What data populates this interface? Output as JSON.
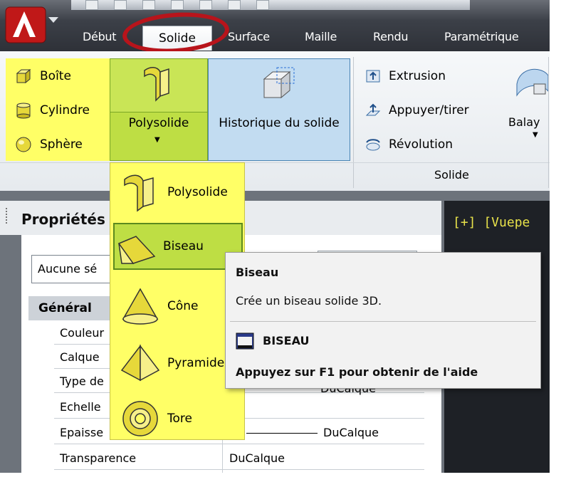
{
  "ribbon_tabs": [
    "Début",
    "Solide",
    "Surface",
    "Maille",
    "Rendu",
    "Paramétrique"
  ],
  "active_tab": "Solide",
  "primitives": [
    "Boîte",
    "Cylindre",
    "Sphère"
  ],
  "polysolid_button": {
    "label": "Polysolide"
  },
  "history_button": {
    "label": "Historique du solide"
  },
  "solid_tools": [
    "Extrusion",
    "Appuyer/tirer",
    "Révolution"
  ],
  "sweep_label": "Balay",
  "panel_label": "Solide",
  "dropdown": {
    "items": [
      "Polysolide",
      "Biseau",
      "Cône",
      "Pyramide",
      "Tore"
    ],
    "highlighted": "Biseau"
  },
  "tooltip": {
    "title": "Biseau",
    "description": "Crée un biseau solide 3D.",
    "command": "BISEAU",
    "help": "Appuyez sur F1 pour obtenir de l'aide"
  },
  "properties": {
    "title": "Propriétés",
    "selection": "Aucune sé",
    "category": "Général",
    "rows": [
      {
        "name": "Couleur",
        "value": ""
      },
      {
        "name": "Calque",
        "value": ""
      },
      {
        "name": "Type de",
        "value": "DuCalque"
      },
      {
        "name": "Echelle",
        "value": ""
      },
      {
        "name": "Epaisse",
        "value": "DuCalque"
      },
      {
        "name": "Transparence",
        "value": "DuCalque"
      }
    ]
  },
  "viewport": {
    "label": "[+] [Vuepe"
  },
  "colors": {
    "highlight_yellow": "#ffff66",
    "active_green": "#bede44",
    "history_blue": "#c2dcf1",
    "annotation_red": "#b8141b",
    "viewport_bg": "#1e2126"
  }
}
